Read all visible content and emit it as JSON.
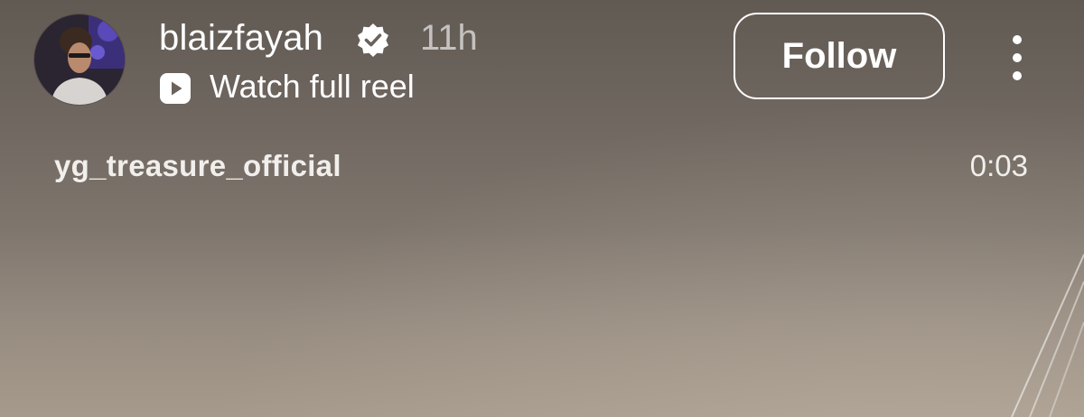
{
  "post": {
    "username": "blaizfayah",
    "verified_icon": "verified-badge-icon",
    "time_ago": "11h",
    "watch_link_icon": "play-reel-icon",
    "watch_link_label": "Watch full reel",
    "follow_label": "Follow",
    "more_icon": "more-vertical-icon"
  },
  "video": {
    "audio_handle": "yg_treasure_official",
    "timestamp": "0:03"
  },
  "colors": {
    "text": "#ffffff",
    "muted_text": "#b9b3ad",
    "background_top": "#615a53",
    "background_bottom": "#a69a8c"
  }
}
